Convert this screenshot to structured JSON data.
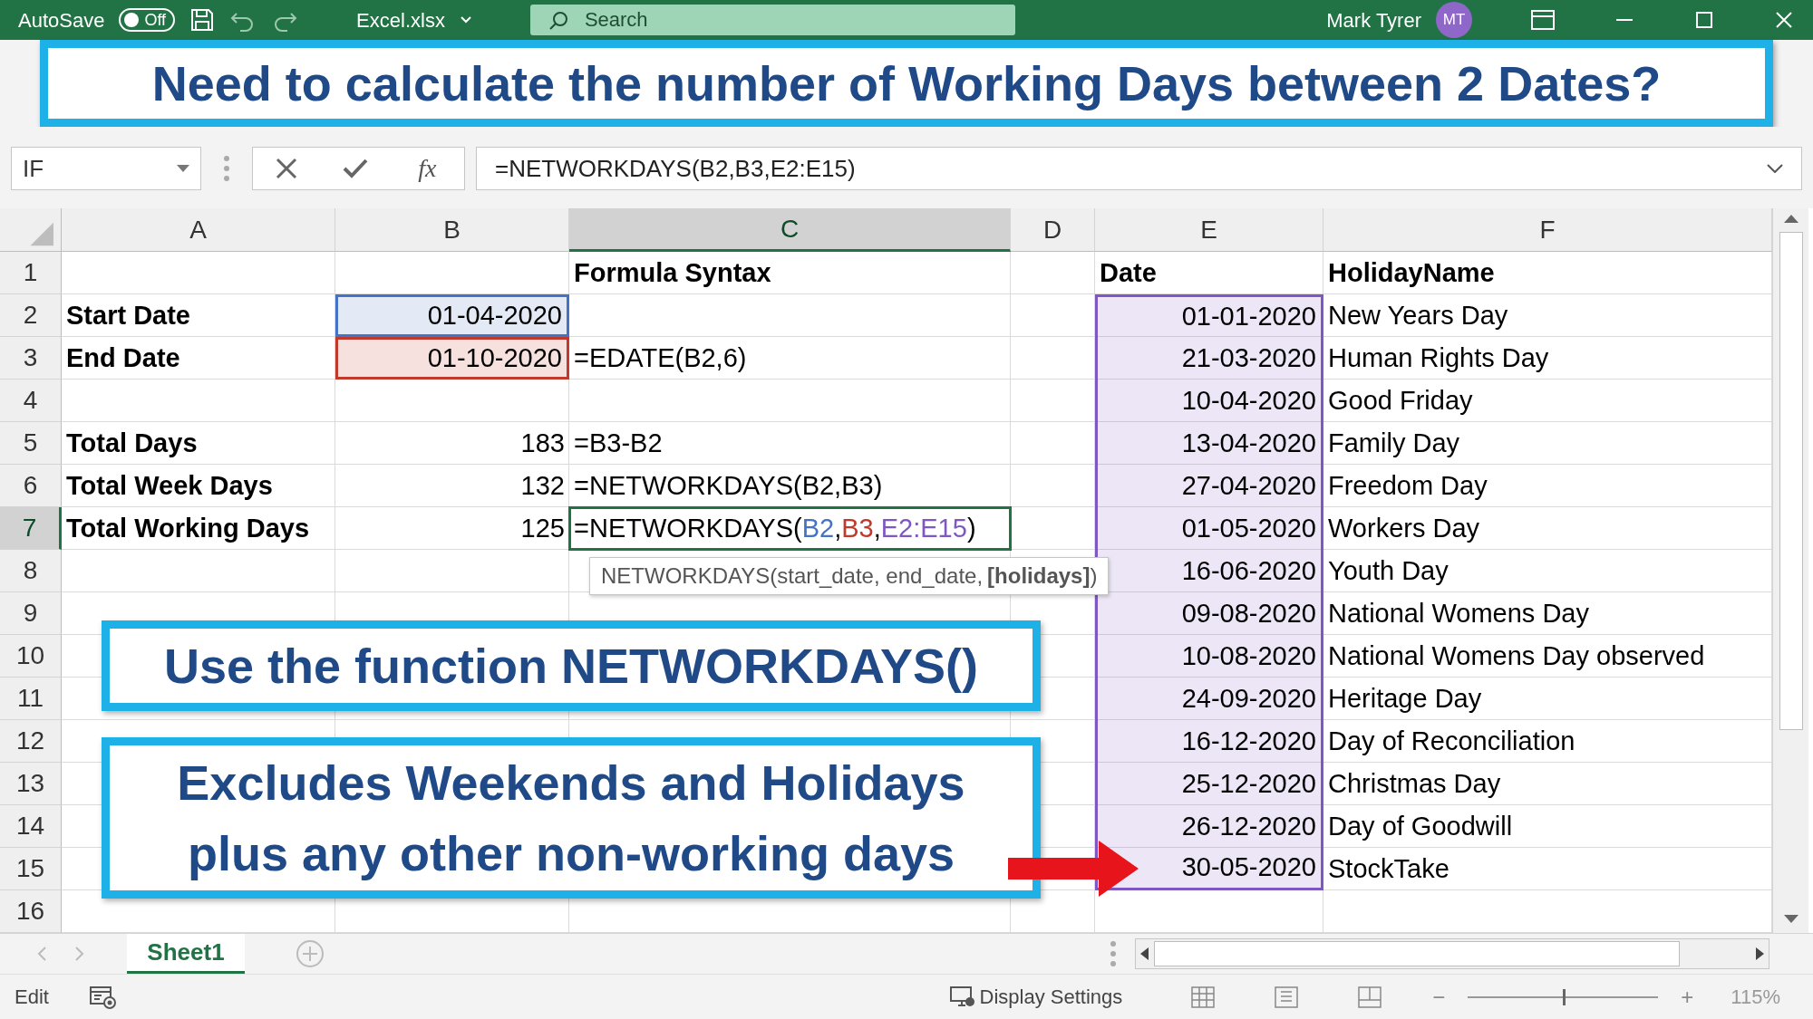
{
  "title_bar": {
    "autosave_label": "AutoSave",
    "autosave": {
      "label": "Off",
      "on": false
    },
    "file_name": "Excel.xlsx",
    "search": {
      "placeholder": "Search"
    },
    "user_name": "Mark Tyrer",
    "avatar_initials": "MT"
  },
  "banner": "Need to calculate the number of Working Days between 2 Dates?",
  "formula_bar": {
    "name_box": "IF",
    "function_label": "fx",
    "formula": "=NETWORKDAYS(B2,B3,E2:E15)"
  },
  "columns": [
    {
      "label": "A",
      "selected": false
    },
    {
      "label": "B",
      "selected": false
    },
    {
      "label": "C",
      "selected": true
    },
    {
      "label": "D",
      "selected": false
    },
    {
      "label": "E",
      "selected": false
    },
    {
      "label": "F",
      "selected": false
    }
  ],
  "rows": [
    {
      "header": "1",
      "selected": false,
      "cells": [
        null,
        null,
        {
          "text": "Formula Syntax",
          "kind": "heading",
          "selected": false
        },
        null,
        {
          "text": "Date",
          "kind": "heading",
          "selected": false
        },
        {
          "text": "HolidayName",
          "kind": "heading",
          "selected": false
        }
      ]
    },
    {
      "header": "2",
      "selected": false,
      "cells": [
        {
          "text": "Start Date",
          "kind": "label",
          "selected": false
        },
        {
          "text": "01-04-2020",
          "kind": "number",
          "color": "#4472c4",
          "selected": false
        },
        null,
        null,
        {
          "text": "01-01-2020",
          "kind": "number",
          "color": "#7e57c2",
          "selected": false
        },
        {
          "text": "New Years Day",
          "kind": "text",
          "selected": false
        }
      ]
    },
    {
      "header": "3",
      "selected": false,
      "cells": [
        {
          "text": "End Date",
          "kind": "label",
          "selected": false
        },
        {
          "text": "01-10-2020",
          "kind": "number",
          "color": "#c0392b",
          "selected": false
        },
        {
          "text": "=EDATE(B2,6)",
          "kind": "text",
          "selected": false
        },
        null,
        {
          "text": "21-03-2020",
          "kind": "number",
          "color": "#7e57c2",
          "selected": false
        },
        {
          "text": "Human Rights Day",
          "kind": "text",
          "selected": false
        }
      ]
    },
    {
      "header": "4",
      "selected": false,
      "cells": [
        null,
        null,
        null,
        null,
        {
          "text": "10-04-2020",
          "kind": "number",
          "color": "#7e57c2",
          "selected": false
        },
        {
          "text": "Good Friday",
          "kind": "text",
          "selected": false
        }
      ]
    },
    {
      "header": "5",
      "selected": false,
      "cells": [
        {
          "text": "Total Days",
          "kind": "label",
          "selected": false
        },
        {
          "text": "183",
          "kind": "number",
          "selected": false
        },
        {
          "text": "=B3-B2",
          "kind": "text",
          "selected": false
        },
        null,
        {
          "text": "13-04-2020",
          "kind": "number",
          "color": "#7e57c2",
          "selected": false
        },
        {
          "text": "Family Day",
          "kind": "text",
          "selected": false
        }
      ]
    },
    {
      "header": "6",
      "selected": false,
      "cells": [
        {
          "text": "Total Week Days",
          "kind": "label",
          "selected": false
        },
        {
          "text": "132",
          "kind": "number",
          "selected": false
        },
        {
          "text": "=NETWORKDAYS(B2,B3)",
          "kind": "text",
          "selected": false
        },
        null,
        {
          "text": "27-04-2020",
          "kind": "number",
          "color": "#7e57c2",
          "selected": false
        },
        {
          "text": "Freedom Day",
          "kind": "text",
          "selected": false
        }
      ]
    },
    {
      "header": "7",
      "selected": true,
      "cells": [
        {
          "text": "Total Working Days",
          "kind": "label",
          "selected": false
        },
        {
          "text": "125",
          "kind": "number",
          "selected": false
        },
        {
          "kind": "formula",
          "selected": true,
          "parts": [
            {
              "text": "=NETWORKDAYS("
            },
            {
              "text": "B2",
              "color": "#4472c4"
            },
            {
              "text": ","
            },
            {
              "text": "B3",
              "color": "#c0392b"
            },
            {
              "text": ","
            },
            {
              "text": "E2:E15",
              "color": "#7e57c2"
            },
            {
              "text": ")"
            }
          ]
        },
        null,
        {
          "text": "01-05-2020",
          "kind": "number",
          "color": "#7e57c2",
          "selected": false
        },
        {
          "text": "Workers Day",
          "kind": "text",
          "selected": false
        }
      ]
    },
    {
      "header": "8",
      "selected": false,
      "cells": [
        null,
        null,
        null,
        null,
        {
          "text": "16-06-2020",
          "kind": "number",
          "color": "#7e57c2",
          "selected": false
        },
        {
          "text": "Youth Day",
          "kind": "text",
          "selected": false
        }
      ]
    },
    {
      "header": "9",
      "selected": false,
      "cells": [
        null,
        null,
        null,
        null,
        {
          "text": "09-08-2020",
          "kind": "number",
          "color": "#7e57c2",
          "selected": false
        },
        {
          "text": "National Womens Day",
          "kind": "text",
          "selected": false
        }
      ]
    },
    {
      "header": "10",
      "selected": false,
      "cells": [
        null,
        null,
        null,
        null,
        {
          "text": "10-08-2020",
          "kind": "number",
          "color": "#7e57c2",
          "selected": false
        },
        {
          "text": "National Womens Day observed",
          "kind": "text",
          "selected": false
        }
      ]
    },
    {
      "header": "11",
      "selected": false,
      "cells": [
        null,
        null,
        null,
        null,
        {
          "text": "24-09-2020",
          "kind": "number",
          "color": "#7e57c2",
          "selected": false
        },
        {
          "text": "Heritage Day",
          "kind": "text",
          "selected": false
        }
      ]
    },
    {
      "header": "12",
      "selected": false,
      "cells": [
        null,
        null,
        null,
        null,
        {
          "text": "16-12-2020",
          "kind": "number",
          "color": "#7e57c2",
          "selected": false
        },
        {
          "text": "Day of Reconciliation",
          "kind": "text",
          "selected": false
        }
      ]
    },
    {
      "header": "13",
      "selected": false,
      "cells": [
        null,
        null,
        null,
        null,
        {
          "text": "25-12-2020",
          "kind": "number",
          "color": "#7e57c2",
          "selected": false
        },
        {
          "text": "Christmas Day",
          "kind": "text",
          "selected": false
        }
      ]
    },
    {
      "header": "14",
      "selected": false,
      "cells": [
        null,
        null,
        null,
        null,
        {
          "text": "26-12-2020",
          "kind": "number",
          "color": "#7e57c2",
          "selected": false
        },
        {
          "text": "Day of Goodwill",
          "kind": "text",
          "selected": false
        }
      ]
    },
    {
      "header": "15",
      "selected": false,
      "cells": [
        null,
        null,
        null,
        null,
        {
          "text": "30-05-2020",
          "kind": "number",
          "color": "#7e57c2",
          "selected": false
        },
        {
          "text": "StockTake",
          "kind": "text",
          "selected": false
        }
      ]
    },
    {
      "header": "16",
      "selected": false,
      "cells": [
        null,
        null,
        null,
        null,
        null,
        null
      ]
    }
  ],
  "tooltip": "NETWORKDAYS(start_date, end_date, **[holidays]**)",
  "callouts": [
    {
      "lines": [
        "Use the function NETWORKDAYS()"
      ]
    },
    {
      "lines": [
        "Excludes Weekends and Holidays",
        "plus any other non-working days"
      ]
    }
  ],
  "sheet_tabs": [
    {
      "label": "Sheet1",
      "selected": true
    }
  ],
  "status_bar": {
    "mode": "Edit",
    "display_settings": "Display Settings",
    "zoom_out": "−",
    "zoom_in": "+",
    "zoom_slider": {
      "level": 0.5
    },
    "zoom": "115%"
  }
}
